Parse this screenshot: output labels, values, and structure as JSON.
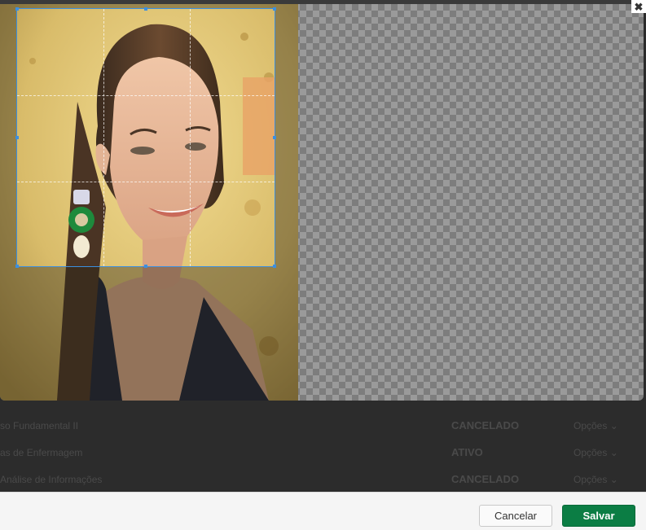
{
  "dialog": {
    "close_glyph": "✖",
    "cancel_label": "Cancelar",
    "save_label": "Salvar",
    "colors": {
      "crop_handles": "#3b8fe0",
      "save_button": "#0b7d44"
    }
  },
  "background_table": {
    "rows": [
      {
        "name": "so Fundamental II",
        "status": "CANCELADO",
        "options": "Opções"
      },
      {
        "name": "as de Enfermagem",
        "status": "ATIVO",
        "options": "Opções"
      },
      {
        "name": "Análise de Informações",
        "status": "CANCELADO",
        "options": "Opções"
      }
    ]
  },
  "icons": {
    "close": "close-icon",
    "row_options": "chevron-down-icon"
  }
}
